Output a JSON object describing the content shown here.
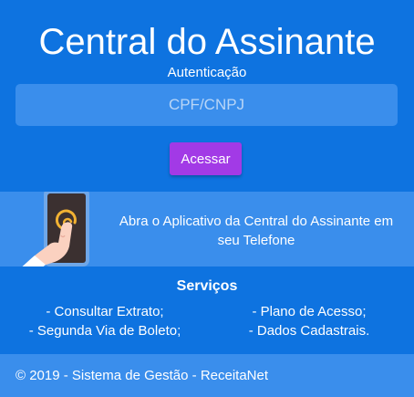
{
  "header": {
    "title": "Central do Assinante",
    "subtitle": "Autenticação"
  },
  "login": {
    "cpf_placeholder": "CPF/CNPJ",
    "cpf_value": "",
    "submit_label": "Acessar"
  },
  "app_promo": {
    "icon": "tap-phone-icon",
    "text": "Abra o Aplicativo da Central do Assinante em seu Telefone"
  },
  "services": {
    "title": "Serviços",
    "items": [
      "- Consultar Extrato;",
      "- Plano de Acesso;",
      "- Segunda Via de Boleto;",
      "- Dados Cadastrais."
    ]
  },
  "footer": {
    "text": "© 2019 - Sistema de Gestão - ReceitaNet"
  },
  "colors": {
    "primary": "#0e73e0",
    "band": "#3a8eec",
    "button": "#a23ae6"
  }
}
